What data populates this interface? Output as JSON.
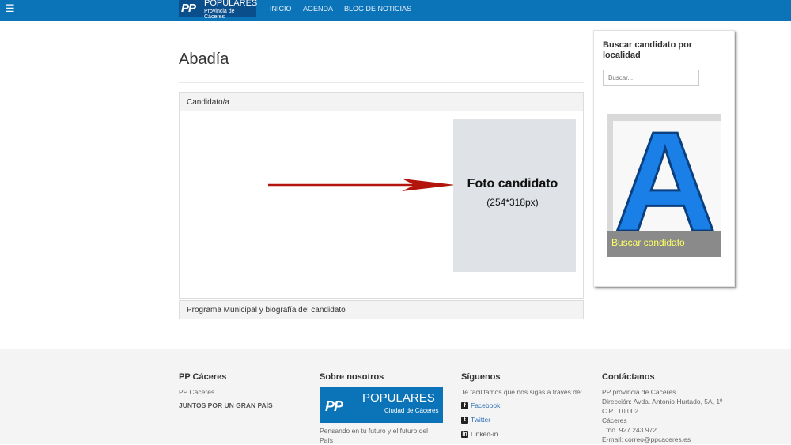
{
  "nav": {
    "logo_pp": "PP",
    "logo_line1": "POPULARES",
    "logo_line2": "Provincia de Cáceres",
    "items": [
      "INICIO",
      "AGENDA",
      "BLOG DE NOTICIAS"
    ]
  },
  "main": {
    "title": "Abadía",
    "candidate_header": "Candidato/a",
    "photo_title": "Foto candidato",
    "photo_size": "(254*318px)",
    "program_header": "Programa Municipal y biografía del candidato"
  },
  "sidebar": {
    "title": "Buscar candidato por localidad",
    "search_placeholder": "Buscar...",
    "promo_letter": "A",
    "promo_caption": "Buscar candidato"
  },
  "footer": {
    "col1": {
      "heading": "PP Cáceres",
      "text": "PP Cáceres",
      "bold": "JUNTOS POR UN GRAN PAÍS"
    },
    "col2": {
      "heading": "Sobre nosotros",
      "banner_pp": "PP",
      "banner_line1": "POPULARES",
      "banner_line2": "Ciudad de Cáceres",
      "text1": "Pensando en tu futuro y el futuro del",
      "text2": "País"
    },
    "col3": {
      "heading": "Síguenos",
      "intro": "Te facilitamos que nos sigas a través de:",
      "links": [
        "Facebook",
        "Twitter",
        "Linked-in"
      ]
    },
    "col4": {
      "heading": "Contáctanos",
      "lines": [
        "PP provincia de Cáceres",
        "Dirección: Avda. Antonio Hurtado, 5A, 1º",
        "C.P.: 10.002",
        "Cáceres",
        "Tfno. 927 243 972",
        "E-mail: correo@ppcaceres.es"
      ]
    }
  },
  "colors": {
    "nav": "#0b74b8",
    "arrow": "#b3140c",
    "promo_blue": "#1a7fe6",
    "promo_caption": "#ffff66"
  }
}
